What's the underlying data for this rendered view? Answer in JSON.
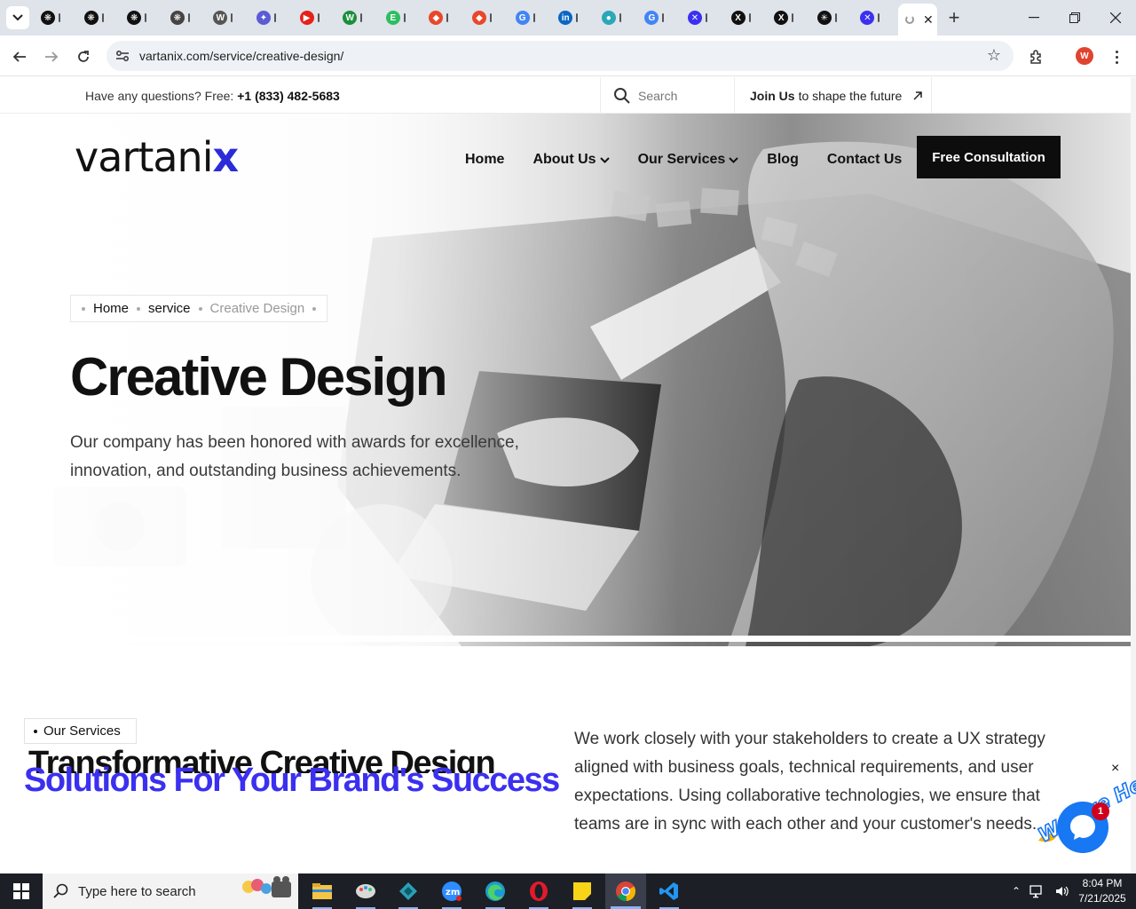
{
  "browser": {
    "url": "vartanix.com/service/creative-design/",
    "tabs": [
      {
        "icon": "openai-icon",
        "color": "#111111"
      },
      {
        "icon": "openai-icon",
        "color": "#111111"
      },
      {
        "icon": "openai-icon",
        "color": "#111111"
      },
      {
        "icon": "openai-icon",
        "color": "#444444"
      },
      {
        "icon": "wordpress-icon",
        "color": "#555555"
      },
      {
        "icon": "ai-icon",
        "color": "#5b5bd6"
      },
      {
        "icon": "youtube-icon",
        "color": "#e62117"
      },
      {
        "icon": "w-icon",
        "color": "#1a8f3a"
      },
      {
        "icon": "evernote-icon",
        "color": "#2dbe60"
      },
      {
        "icon": "diamond-icon",
        "color": "#e8472b"
      },
      {
        "icon": "diamond-icon",
        "color": "#e8472b"
      },
      {
        "icon": "google-icon",
        "color": "#4285f4"
      },
      {
        "icon": "linkedin-icon",
        "color": "#0a66c2"
      },
      {
        "icon": "ai-dot-icon",
        "color": "#2aa8b8"
      },
      {
        "icon": "google-icon",
        "color": "#4285f4"
      },
      {
        "icon": "x-purple-icon",
        "color": "#3b30f0"
      },
      {
        "icon": "x-icon",
        "color": "#111111"
      },
      {
        "icon": "x-icon",
        "color": "#111111"
      },
      {
        "icon": "sparkle-icon",
        "color": "#111111"
      },
      {
        "icon": "x-purple-icon",
        "color": "#3b30f0"
      }
    ],
    "profile_initial": "W"
  },
  "topbar": {
    "question": "Have any questions? Free: ",
    "phone": "+1 (833) 482-5683",
    "search_placeholder": "Search",
    "join_bold": "Join Us",
    "join_rest": "to shape the future"
  },
  "header": {
    "logo_main": "vartani",
    "logo_x": "x",
    "nav": {
      "home": "Home",
      "about": "About Us",
      "services": "Our Services",
      "blog": "Blog",
      "contact": "Contact Us"
    },
    "cta": "Free Consultation"
  },
  "hero": {
    "breadcrumb": {
      "home": "Home",
      "service": "service",
      "current": "Creative Design"
    },
    "title": "Creative Design",
    "subtitle_line1": "Our company has been honored with awards for excellence,",
    "subtitle_line2": "innovation, and outstanding business achievements."
  },
  "services": {
    "tag": "Our Services",
    "heading_back": "Transformative Creative Design",
    "heading_front": "Solutions For Your Brand's Success",
    "description": "We work closely with your stakeholders to create a UX strategy aligned with business goals, technical requirements, and user expectations. Using collaborative technologies, we ensure that teams are in sync with each other and your customer's needs."
  },
  "chat": {
    "banner": "We Are Here!",
    "badge_count": "1",
    "close": "×"
  },
  "taskbar": {
    "search_placeholder": "Type here to search",
    "time": "8:04 PM",
    "date": "7/21/2025"
  },
  "colors": {
    "brand_blue": "#3b30f0",
    "cta_bg": "#0d0d0d",
    "chat_blue": "#1877f2"
  }
}
